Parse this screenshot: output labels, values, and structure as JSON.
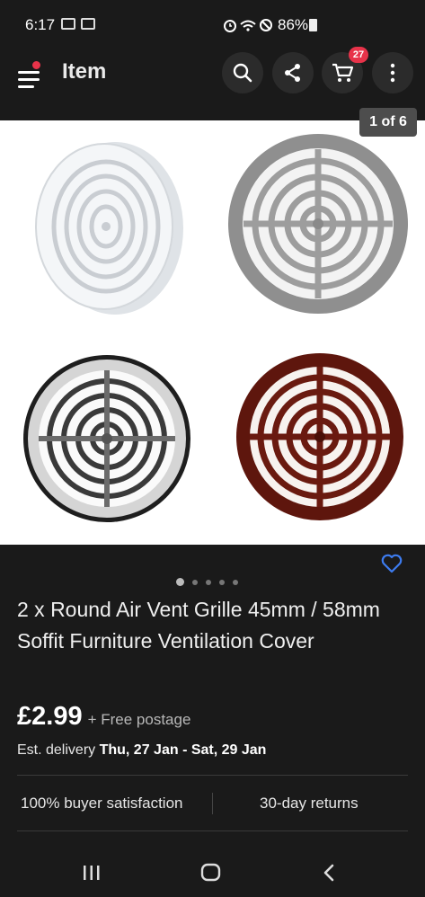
{
  "status_bar": {
    "time": "6:17",
    "battery_percent": "86%",
    "icons": [
      "gallery-notification-icon",
      "screenshot-icon",
      "alarm-icon",
      "wifi-icon",
      "do-not-disturb-icon",
      "battery-icon"
    ]
  },
  "app_bar": {
    "title": "Item",
    "cart_count": "27",
    "icons": [
      "hamburger-menu-icon",
      "search-icon",
      "share-icon",
      "cart-icon",
      "more-vertical-icon"
    ]
  },
  "gallery": {
    "counter": "1 of 6",
    "variants": [
      "white",
      "silver",
      "chrome",
      "brown"
    ],
    "colors": {
      "white": "#f2f4f6",
      "silver": "#9a9a9a",
      "chrome": "#c9c9c9",
      "brown": "#6a1a10"
    },
    "dots_total": 5,
    "dots_active_index": 0
  },
  "listing": {
    "title": "2 x Round Air Vent Grille 45mm / 58mm Soffit Furniture Ventilation Cover",
    "price": "£2.99",
    "postage": "+ Free postage",
    "delivery_prefix": "Est. delivery",
    "delivery_dates": "Thu, 27 Jan - Sat, 29 Jan",
    "satisfaction": "100% buyer satisfaction",
    "returns": "30-day returns"
  },
  "colors": {
    "background": "#1a1a1a",
    "accent_badge": "#e8334a",
    "watch_heart": "#3d7cf0"
  },
  "nav_bar": {
    "icons": [
      "recent-apps-icon",
      "home-icon",
      "back-icon"
    ]
  }
}
